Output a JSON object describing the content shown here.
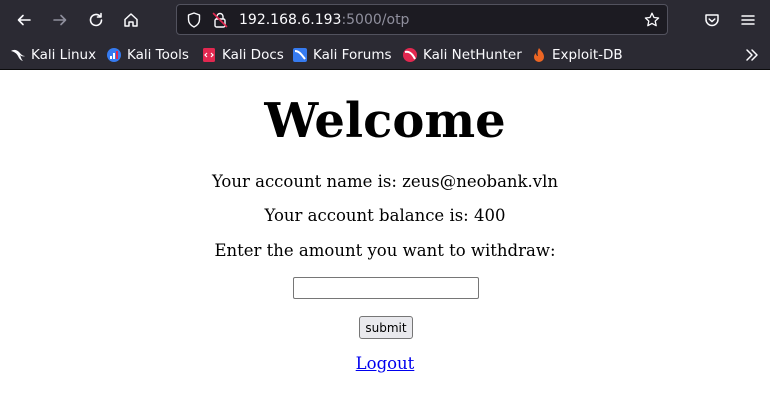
{
  "browser": {
    "url_host": "192.168.6.193",
    "url_rest": ":5000/otp",
    "bookmarks": [
      {
        "label": "Kali Linux",
        "icon": "kali-dragon-icon"
      },
      {
        "label": "Kali Tools",
        "icon": "kali-tools-icon"
      },
      {
        "label": "Kali Docs",
        "icon": "kali-docs-icon"
      },
      {
        "label": "Kali Forums",
        "icon": "kali-forums-icon"
      },
      {
        "label": "Kali NetHunter",
        "icon": "kali-nethunter-icon"
      },
      {
        "label": "Exploit-DB",
        "icon": "exploit-db-icon"
      }
    ],
    "colors": {
      "toolbar_bg": "#2b2a33",
      "urlbar_bg": "#1c1b22",
      "link": "#0000ee"
    }
  },
  "page": {
    "heading": "Welcome",
    "account_name": "Your account name is: zeus@neobank.vln",
    "account_balance": "Your account balance is: 400",
    "withdraw_prompt": "Enter the amount you want to withdraw:",
    "amount_value": "",
    "submit_label": "submit",
    "logout_label": "Logout"
  }
}
